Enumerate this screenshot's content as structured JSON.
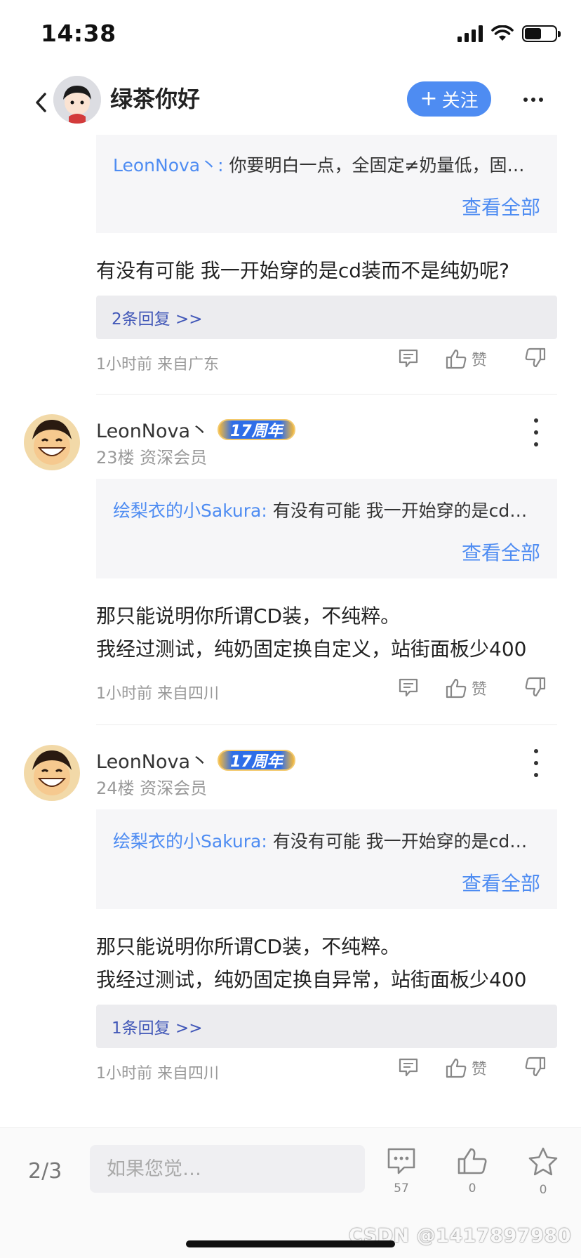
{
  "status_bar": {
    "time": "14:38"
  },
  "header": {
    "name": "绿茶你好",
    "follow_label": "关注"
  },
  "posts": [
    {
      "quote": {
        "user": "LeonNova丶:",
        "text": " 你要明白一点，全固定≠奶量低，固…",
        "view_all": "查看全部"
      },
      "content": "有没有可能 我一开始穿的是cd装而不是纯奶呢?",
      "replies": "2条回复 >>",
      "meta": "1小时前 来自广东",
      "like_label": "赞"
    },
    {
      "username": "LeonNova丶",
      "badge": "17周年",
      "floor": "23楼 资深会员",
      "quote": {
        "user": "绘梨衣的小Sakura:",
        "text": " 有没有可能 我一开始穿的是cd…",
        "view_all": "查看全部"
      },
      "content_lines": [
        "那只能说明你所谓CD装，不纯粹。",
        "我经过测试，纯奶固定换自定义，站街面板少400"
      ],
      "meta": "1小时前 来自四川",
      "like_label": "赞"
    },
    {
      "username": "LeonNova丶",
      "badge": "17周年",
      "floor": "24楼 资深会员",
      "quote": {
        "user": "绘梨衣的小Sakura:",
        "text": " 有没有可能 我一开始穿的是cd…",
        "view_all": "查看全部"
      },
      "content_lines": [
        "那只能说明你所谓CD装，不纯粹。",
        "我经过测试，纯奶固定换自异常，站街面板少400"
      ],
      "replies": "1条回复 >>",
      "meta": "1小时前 来自四川",
      "like_label": "赞"
    }
  ],
  "bottom_bar": {
    "page": "2/3",
    "input_placeholder": "如果您觉…",
    "comment_count": "57",
    "like_count": "0",
    "favorite_count": "0",
    "watermark": "CSDN @1417897980"
  },
  "colors": {
    "accent": "#4e8cf2",
    "reply_link": "#4258b8"
  }
}
